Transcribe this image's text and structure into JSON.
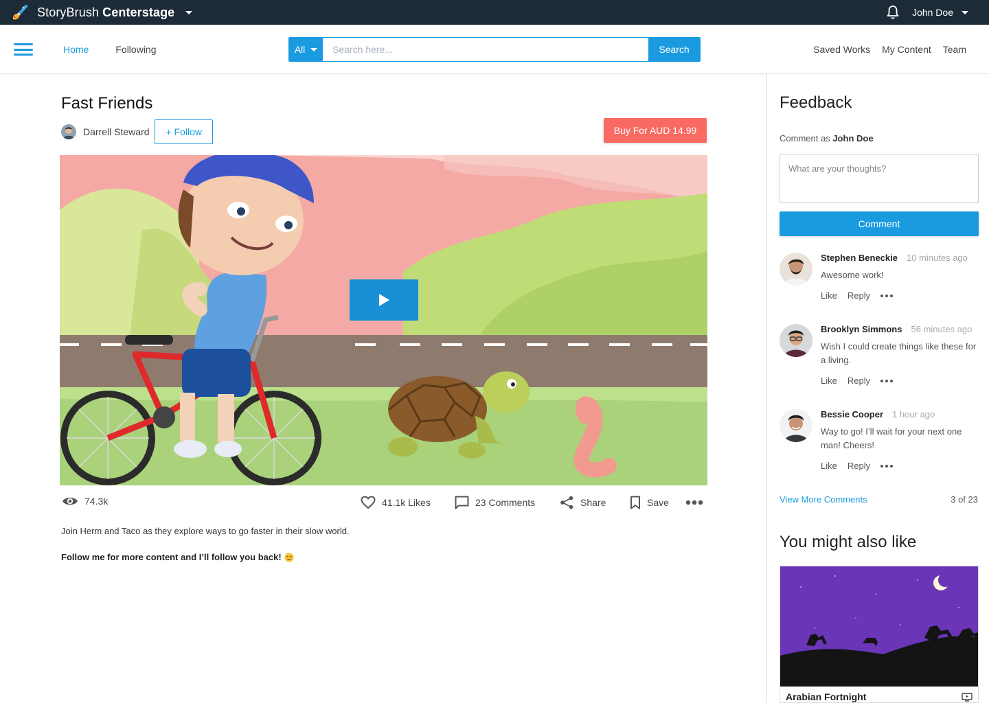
{
  "app": {
    "brand_regular": "StoryBrush",
    "brand_bold": "Centerstage",
    "user_name": "John Doe",
    "accent_color": "#1a9be0",
    "topbar_color": "#1d2b38"
  },
  "nav": {
    "left": [
      "Home",
      "Following"
    ],
    "active": "Home",
    "right": [
      "Saved Works",
      "My Content",
      "Team"
    ]
  },
  "search": {
    "filter_label": "All",
    "placeholder": "Search here...",
    "button_label": "Search"
  },
  "story": {
    "title": "Fast Friends",
    "author": "Darrell Steward",
    "follow_label": "+ Follow",
    "buy_label": "Buy For AUD 14.99",
    "views": "74.3k",
    "likes": "41.1k Likes",
    "comments": "23 Comments",
    "share": "Share",
    "save": "Save",
    "description": "Join Herm and Taco as they explore ways to go faster in their slow world.",
    "cta": "Follow me for more content and I’ll follow you back!"
  },
  "feedback": {
    "title": "Feedback",
    "comment_as_prefix": "Comment as",
    "comment_as_user": "John Doe",
    "placeholder": "What are your thoughts?",
    "comment_button": "Comment",
    "like_label": "Like",
    "reply_label": "Reply",
    "comments": [
      {
        "name": "Stephen Beneckie",
        "time": "10 minutes ago",
        "text": "Awesome work!"
      },
      {
        "name": "Brooklyn Simmons",
        "time": "56 minutes ago",
        "text": "Wish I could create things like these for a living."
      },
      {
        "name": "Bessie Cooper",
        "time": "1 hour ago",
        "text": "Way to go! I’ll wait for your next one man! Cheers!"
      }
    ],
    "view_more": "View More Comments",
    "count": "3 of 23"
  },
  "recommendations": {
    "title": "You might also like",
    "items": [
      {
        "title": "Arabian Fortnight",
        "icon": "video-icon"
      }
    ]
  },
  "icons": [
    "paintbrush-logo-icon",
    "bell-icon",
    "hamburger-icon",
    "eye-icon",
    "heart-icon",
    "comment-icon",
    "share-icon",
    "bookmark-icon",
    "more-icon",
    "play-icon",
    "wink-emoji-icon"
  ]
}
